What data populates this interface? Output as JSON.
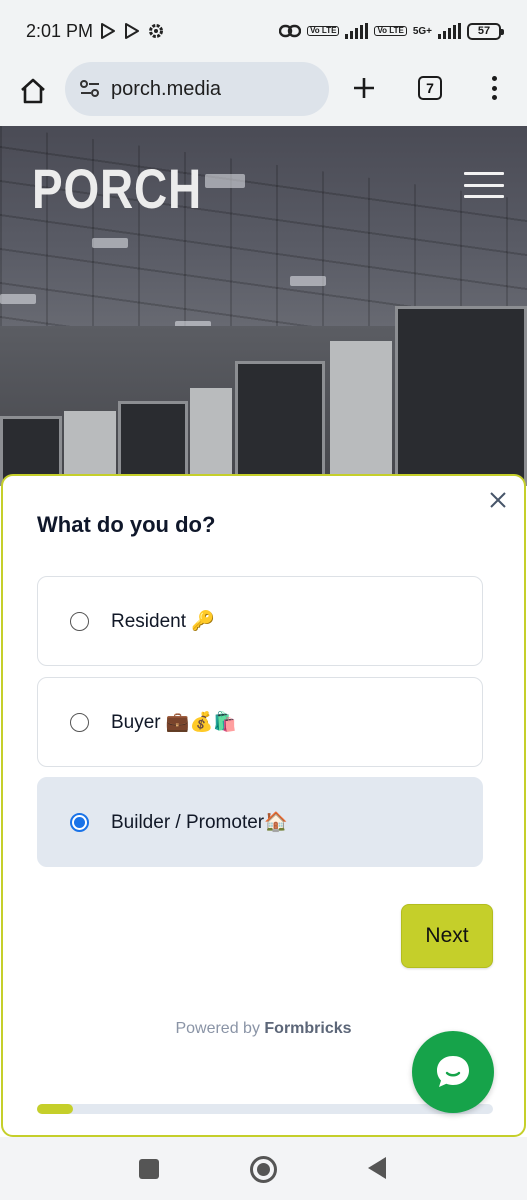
{
  "status_bar": {
    "time": "2:01 PM",
    "network": "5G+",
    "volte_1": "Vo LTE",
    "volte_2": "Vo LTE",
    "battery": "57"
  },
  "browser": {
    "url": "porch.media",
    "tab_count": "7"
  },
  "site": {
    "brand": "PORCH"
  },
  "survey": {
    "question": "What do you do?",
    "options": [
      {
        "label": "Resident 🔑",
        "selected": false
      },
      {
        "label": "Buyer 💼💰🛍️",
        "selected": false
      },
      {
        "label": "Builder / Promoter🏠",
        "selected": true
      }
    ],
    "next_label": "Next",
    "powered_prefix": "Powered by",
    "powered_brand": "Formbricks",
    "progress": 0.08,
    "accent_color": "#c5cf2a",
    "selected_color": "#1a73e8"
  },
  "chat": {
    "icon": "chat-bubble-icon",
    "color": "#16a34a"
  }
}
